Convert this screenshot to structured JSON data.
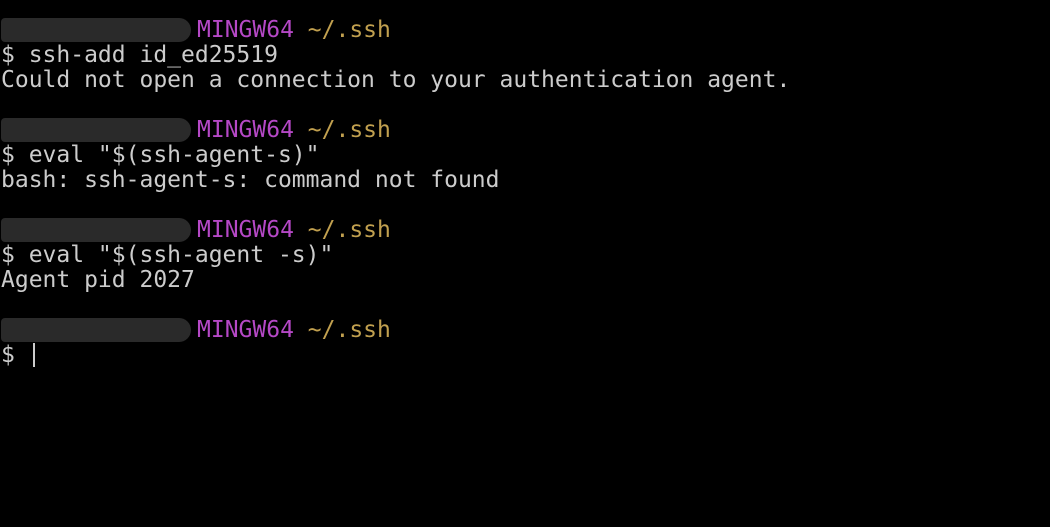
{
  "colors": {
    "background": "#000000",
    "text": "#cccccc",
    "host": "#b548c6",
    "path": "#c1a04f"
  },
  "blocks": [
    {
      "host": "MINGW64",
      "path": "~/.ssh",
      "command": "$ ssh-add id_ed25519",
      "output": "Could not open a connection to your authentication agent."
    },
    {
      "host": "MINGW64",
      "path": "~/.ssh",
      "command": "$ eval \"$(ssh-agent-s)\"",
      "output": "bash: ssh-agent-s: command not found"
    },
    {
      "host": "MINGW64",
      "path": "~/.ssh",
      "command": "$ eval \"$(ssh-agent -s)\"",
      "output": "Agent pid 2027"
    },
    {
      "host": "MINGW64",
      "path": "~/.ssh",
      "command": "$ "
    }
  ]
}
